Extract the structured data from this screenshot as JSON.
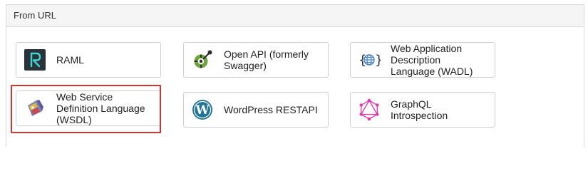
{
  "panel": {
    "title": "From URL"
  },
  "cards": [
    {
      "id": "raml",
      "label": "RAML",
      "icon": "raml-icon"
    },
    {
      "id": "openapi",
      "label": "Open API (formerly Swagger)",
      "icon": "openapi-icon"
    },
    {
      "id": "wadl",
      "label": "Web Application Description Language (WADL)",
      "icon": "globe-braces-icon"
    },
    {
      "id": "wsdl",
      "label": "Web Service Definition Language (WSDL)",
      "icon": "wsdl-icon",
      "selected": true
    },
    {
      "id": "wordpress",
      "label": "WordPress RESTAPI",
      "icon": "wordpress-icon"
    },
    {
      "id": "graphql",
      "label": "GraphQL Introspection",
      "icon": "graphql-icon"
    }
  ],
  "colors": {
    "selection": "#d23434",
    "graphql": "#e535ab",
    "wordpress": "#21759b",
    "openapi": "#6ba539"
  }
}
